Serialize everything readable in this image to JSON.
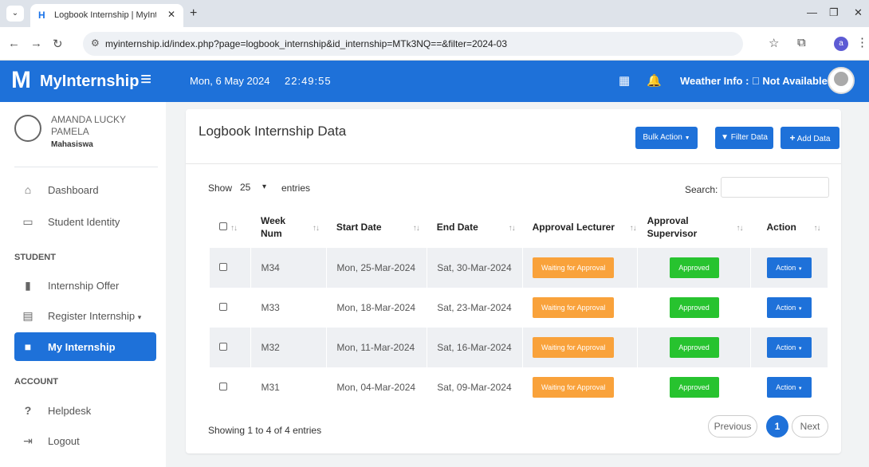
{
  "browser": {
    "tab_title": "Logbook Internship | MyInterns",
    "url": "myinternship.id/index.php?page=logbook_internship&id_internship=MTk3NQ==&filter=2024-03",
    "profile_initial": "a",
    "icons": {
      "tab_dropdown": "chevron-down",
      "close": "close",
      "new_tab": "plus",
      "back": "arrow-left",
      "forward": "arrow-right",
      "reload": "reload",
      "site_info": "tune",
      "bookmark": "star",
      "extensions": "puzzle",
      "menu": "kebab",
      "minimize": "minimize",
      "restore": "restore",
      "close_window": "close"
    }
  },
  "app": {
    "logo_text": "MyInternship",
    "header": {
      "date": "Mon, 6 May 2024",
      "time": "22:49:55",
      "weather_label": "Weather Info : ",
      "weather_value": "Not Available"
    }
  },
  "sidebar": {
    "user": {
      "name": "AMANDA LUCKY PAMELA",
      "role": "Mahasiswa"
    },
    "items": [
      {
        "label": "Dashboard",
        "icon": "home-icon"
      },
      {
        "label": "Student Identity",
        "icon": "id-card-icon"
      }
    ],
    "section_student": "STUDENT",
    "student_items": [
      {
        "label": "Internship Offer",
        "icon": "building-icon"
      },
      {
        "label": "Register Internship",
        "icon": "form-icon"
      },
      {
        "label": "My Internship",
        "icon": "briefcase-icon",
        "active": true
      }
    ],
    "section_account": "ACCOUNT",
    "account_items": [
      {
        "label": "Helpdesk",
        "icon": "question-icon"
      },
      {
        "label": "Logout",
        "icon": "logout-icon"
      }
    ]
  },
  "main": {
    "title": "Logbook Internship Data",
    "bulk_action": "Bulk Action",
    "filter_data": "Filter Data",
    "add_data": "Add Data",
    "show_label": "Show",
    "page_length": "25",
    "entries_label": "entries",
    "search_label": "Search:",
    "columns": [
      "",
      "Week Num",
      "Start Date",
      "End Date",
      "Approval Lecturer",
      "Approval Supervisor",
      "Action"
    ],
    "rows": [
      {
        "week": "M34",
        "start": "Mon, 25-Mar-2024",
        "end": "Sat, 30-Mar-2024",
        "lecturer": "Waiting for Approval",
        "supervisor": "Approved",
        "action": "Action"
      },
      {
        "week": "M33",
        "start": "Mon, 18-Mar-2024",
        "end": "Sat, 23-Mar-2024",
        "lecturer": "Waiting for Approval",
        "supervisor": "Approved",
        "action": "Action"
      },
      {
        "week": "M32",
        "start": "Mon, 11-Mar-2024",
        "end": "Sat, 16-Mar-2024",
        "lecturer": "Waiting for Approval",
        "supervisor": "Approved",
        "action": "Action"
      },
      {
        "week": "M31",
        "start": "Mon, 04-Mar-2024",
        "end": "Sat, 09-Mar-2024",
        "lecturer": "Waiting for Approval",
        "supervisor": "Approved",
        "action": "Action"
      }
    ],
    "info": "Showing 1 to 4 of 4 entries",
    "pagination": {
      "previous": "Previous",
      "current": "1",
      "next": "Next"
    }
  },
  "colors": {
    "primary": "#1e71d9",
    "waiting": "#f9a23b",
    "approved": "#27c32f"
  }
}
